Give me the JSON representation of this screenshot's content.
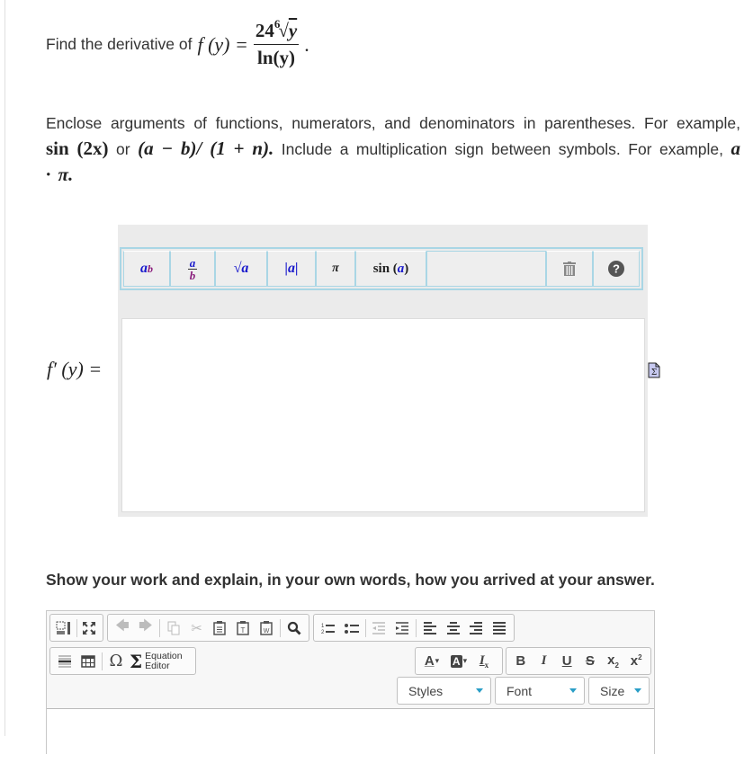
{
  "question": {
    "prompt": "Find the derivative of",
    "function_lhs": "f (y) =",
    "numerator_coef": "24",
    "root_index": "6",
    "root_radicand": "y",
    "denominator": "ln(y)",
    "end_punct": "."
  },
  "instructions": {
    "line1": "Enclose arguments of functions, numerators, and denominators in parentheses. For example,",
    "ex1": "sin (2x)",
    "or": "or",
    "ex2": "(a − b)/ (1 + n).",
    "line2": "Include a multiplication sign between symbols. For example,",
    "ex3": "a · π."
  },
  "math_toolbar": {
    "buttons": [
      {
        "name": "power",
        "label_base": "a",
        "label_sup": "b"
      },
      {
        "name": "fraction",
        "label_num": "a",
        "label_den": "b"
      },
      {
        "name": "sqrt",
        "label": "√a"
      },
      {
        "name": "abs",
        "label": "|a|"
      },
      {
        "name": "pi",
        "label": "π"
      },
      {
        "name": "sin",
        "label_fn": "sin",
        "label_arg": "a"
      }
    ],
    "trash_icon": "trash-icon",
    "help_icon": "help-icon"
  },
  "answer": {
    "label": "f′ (y) =",
    "value": ""
  },
  "show_work": {
    "prompt": "Show your work and explain, in your own words, how you arrived at your answer."
  },
  "editor": {
    "equation_editor_label_1": "Equation",
    "equation_editor_label_2": "Editor",
    "styles_label": "Styles",
    "font_label": "Font",
    "size_label": "Size",
    "text_content": ""
  }
}
